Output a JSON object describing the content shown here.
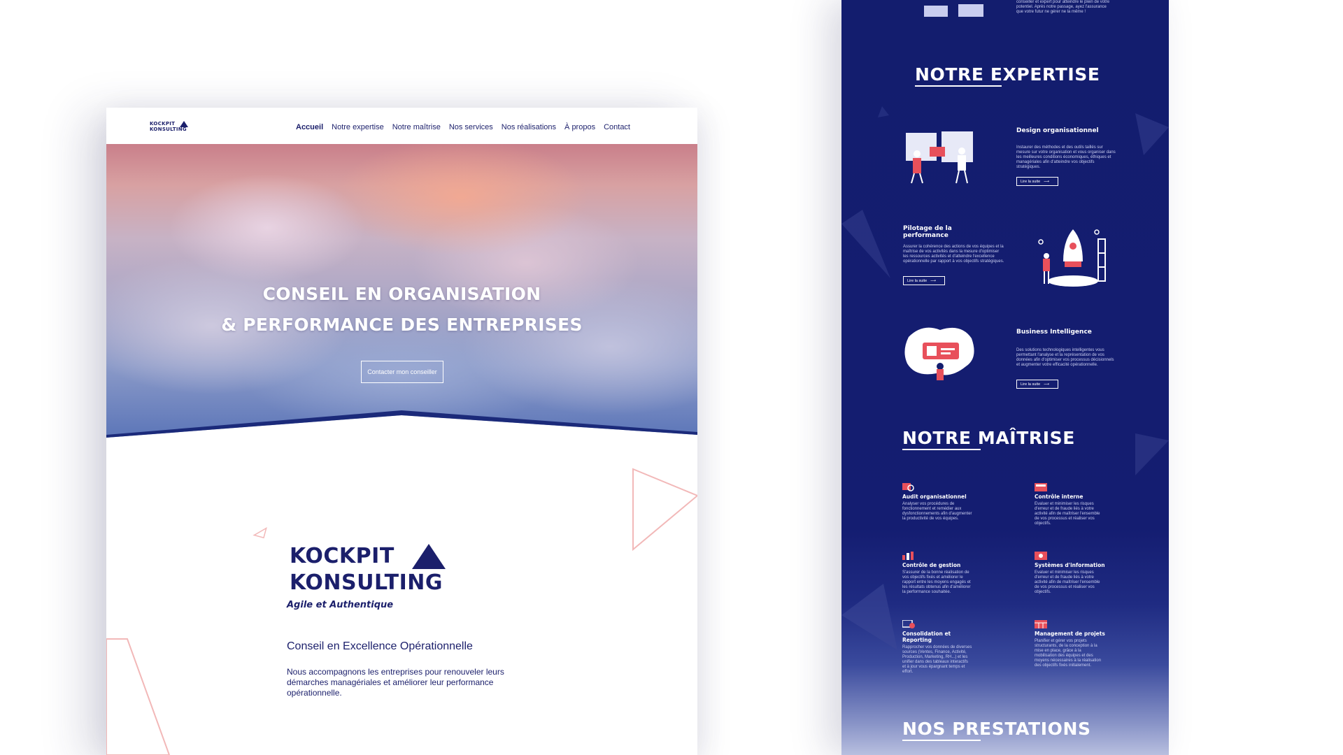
{
  "left": {
    "logo": {
      "line1": "KOCKPIT",
      "line2": "KONSULTING"
    },
    "nav": {
      "items": [
        {
          "label": "Accueil",
          "active": true
        },
        {
          "label": "Notre expertise",
          "active": false
        },
        {
          "label": "Notre maîtrise",
          "active": false
        },
        {
          "label": "Nos services",
          "active": false
        },
        {
          "label": "Nos réalisations",
          "active": false
        },
        {
          "label": "À propos",
          "active": false
        },
        {
          "label": "Contact",
          "active": false
        }
      ]
    },
    "hero": {
      "title_line1": "CONSEIL EN ORGANISATION",
      "title_line2": "& PERFORMANCE DES ENTREPRISES",
      "cta": "Contacter mon conseiller"
    },
    "brand": {
      "word1": "KOCKPIT",
      "word2": "KONSULTING",
      "tagline": "Agile et Authentique"
    },
    "subtitle": "Conseil en Excellence Opérationnelle",
    "intro": "Nous accompagnons les entreprises pour renouveler leurs démarches managériales et améliorer leur performance opérationnelle."
  },
  "right": {
    "top_text": "conseiller et expert pour atteindre le plein de votre potentiel. Après notre passage, ayez l'assurance que votre futur ne gérer ne la même !",
    "expertise": {
      "heading": "NOTRE EXPERTISE",
      "cards": [
        {
          "title": "Design organisationnel",
          "text": "Instaurer des méthodes et des outils taillés sur mesure sur votre organisation et vous organiser dans les meilleures conditions économiques, éthiques et managériales afin d'atteindre vos objectifs stratégiques.",
          "button": "Lire la suite"
        },
        {
          "title": "Pilotage de la performance",
          "text": "Assurer la cohérence des actions de vos équipes et la maîtrise de vos activités dans la mesure d'optimiser les ressources activités et d'atteindre l'excellence opérationnelle par rapport à vos objectifs stratégiques.",
          "button": "Lire la suite"
        },
        {
          "title": "Business Intelligence",
          "text": "Des solutions technologiques intelligentes vous permettant l'analyse et la représentation de vos données afin d'optimiser vos processus décisionnels et augmenter votre efficacité opérationnelle.",
          "button": "Lire la suite"
        }
      ]
    },
    "maitrise": {
      "heading": "NOTRE MAÎTRISE",
      "items": [
        {
          "title": "Audit organisationnel",
          "text": "Analyser vos procédures de fonctionnement et remédier aux dysfonctionnements afin d'augmenter la productivité de vos équipes."
        },
        {
          "title": "Contrôle interne",
          "text": "Evaluer et minimiser les risques d'erreur et de fraude liés à votre activité afin de maîtriser l'ensemble de vos processus et réaliser vos objectifs."
        },
        {
          "title": "Contrôle de gestion",
          "text": "S'assurer de la bonne réalisation de vos objectifs fixés et améliorer le rapport entre les moyens engagés et les résultats obtenus afin d'améliorer la performance souhaitée."
        },
        {
          "title": "Systèmes d'information",
          "text": "Evaluer et minimiser les risques d'erreur et de fraude liés à votre activité afin de maîtriser l'ensemble de vos processus et réaliser vos objectifs."
        },
        {
          "title": "Consolidation et Reporting",
          "text": "Rapprocher vos données de diverses sources (Ventes, Finance, Activité, Production, Marketing, RH...) et les unifier dans des tableaux interactifs et à jour vous épargnant temps et effort."
        },
        {
          "title": "Management de projets",
          "text": "Planifier et gérer vos projets structurants, de la conception à la mise en place, grâce à la mobilisation des équipes et des moyens nécessaires à la réalisation des objectifs fixés initialement."
        }
      ]
    },
    "prestations": {
      "heading": "NOS PRESTATIONS"
    }
  },
  "colors": {
    "navy": "#1b1f6b",
    "deep_navy": "#131d6e",
    "coral": "#e8505b",
    "white": "#ffffff"
  },
  "icons": [
    "triangle-logo-icon",
    "arrow-right-icon",
    "audit-icon",
    "control-icon",
    "chart-icon",
    "system-icon",
    "reporting-icon",
    "project-icon"
  ]
}
